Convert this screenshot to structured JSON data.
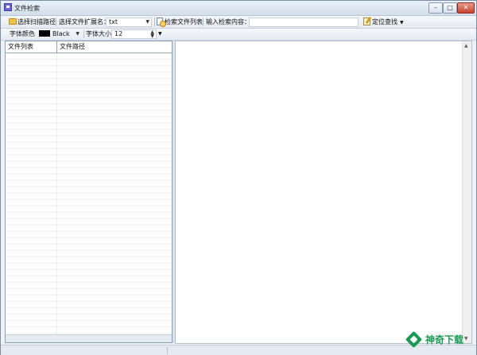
{
  "window": {
    "title": "文件检索"
  },
  "toolbar": {
    "scan_path_label": "选择扫描路径",
    "ext_label": "选择文件扩展名：",
    "ext_value": "txt",
    "list_button": "检索文件列表",
    "search_label": "输入检索内容：",
    "search_value": "",
    "locate_button": "定位查找"
  },
  "fontbar": {
    "color_label": "字体颜色",
    "color_value": "Black",
    "color_hex": "#000000",
    "size_label": "字体大小",
    "size_value": "12"
  },
  "file_table": {
    "columns": [
      "文件列表",
      "文件路径"
    ]
  },
  "watermark": {
    "text": "神奇下载"
  },
  "icons": [
    "app-icon",
    "folder-icon",
    "list-search-icon",
    "locate-icon",
    "minimize-icon",
    "maximize-icon",
    "close-icon"
  ]
}
